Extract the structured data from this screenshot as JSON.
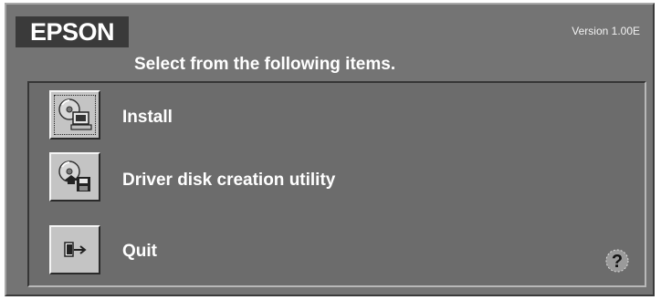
{
  "app": {
    "brand": "EPSON",
    "version": "Version 1.00E",
    "prompt": "Select from the following items."
  },
  "items": [
    {
      "label": "Install",
      "icon": "install-cd-computer-icon"
    },
    {
      "label": "Driver disk creation utility",
      "icon": "driver-disk-cd-floppy-icon"
    },
    {
      "label": "Quit",
      "icon": "exit-door-icon"
    }
  ],
  "help": {
    "icon": "help-question-icon"
  },
  "colors": {
    "window_bg": "#747474",
    "panel_bg": "#6c6c6c",
    "button_face": "#c4c4c4",
    "logo_bg": "#3a3a3a",
    "text": "#ffffff"
  }
}
